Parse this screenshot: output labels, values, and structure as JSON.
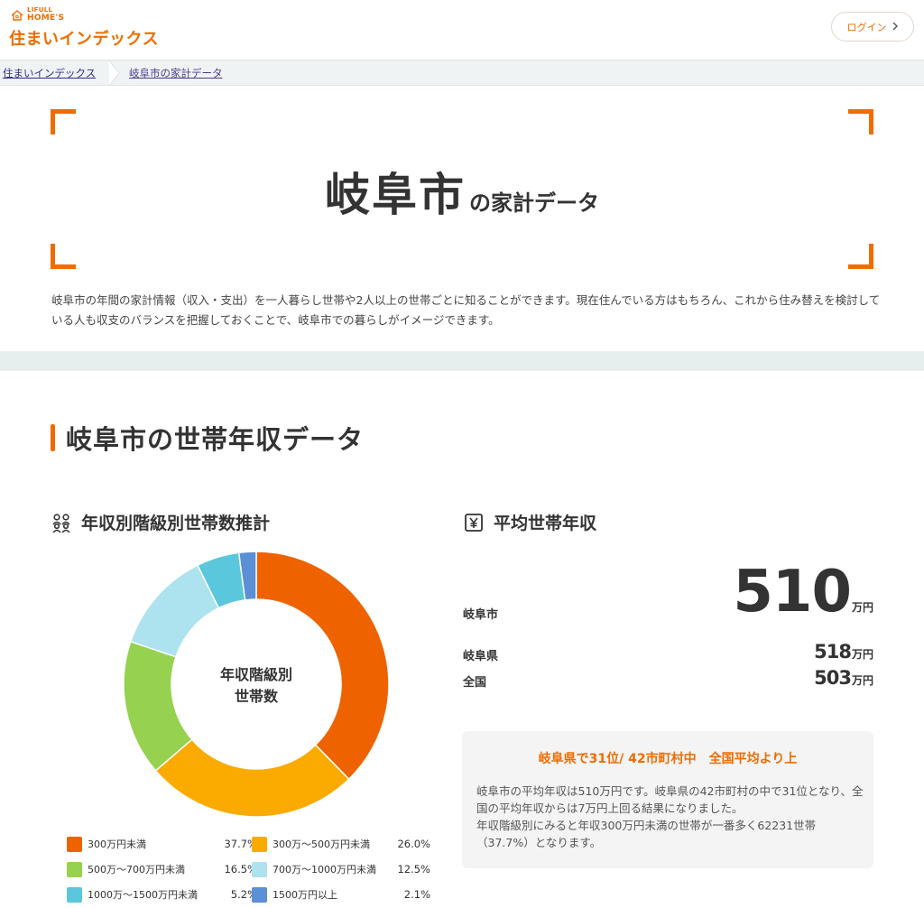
{
  "header": {
    "logo_line1": "LIFULL",
    "logo_line2": "HOME'S",
    "site_title": "住まいインデックス",
    "login_label": "ログイン",
    "login_chevron": "〉"
  },
  "breadcrumb": {
    "items": [
      "住まいインデックス",
      "岐阜市の家計データ"
    ]
  },
  "hero": {
    "city": "岐阜市",
    "suffix": "の家計データ",
    "description": "岐阜市の年間の家計情報（収入・支出）を一人暮らし世帯や2人以上の世帯ごとに知ることができます。現在住んでいる方はもちろん、これから住み替えを検討している人も収支のバランスを把握しておくことで、岐阜市での暮らしがイメージできます。"
  },
  "section": {
    "title": "岐阜市の世帯年収データ"
  },
  "distribution": {
    "heading": "年収別階級別世帯数推計",
    "center_line1": "年収階級別",
    "center_line2": "世帯数",
    "legend": [
      {
        "label": "300万円未満",
        "pct": "37.7%",
        "color": "#ee6300"
      },
      {
        "label": "300万～500万円未満",
        "pct": "26.0%",
        "color": "#fbaa00"
      },
      {
        "label": "500万～700万円未満",
        "pct": "16.5%",
        "color": "#96d150"
      },
      {
        "label": "700万～1000万円未満",
        "pct": "12.5%",
        "color": "#ade3ef"
      },
      {
        "label": "1000万～1500万円未満",
        "pct": "5.2%",
        "color": "#5bc7dc"
      },
      {
        "label": "1500万円以上",
        "pct": "2.1%",
        "color": "#5b8fd6"
      }
    ]
  },
  "chart_data": {
    "type": "pie",
    "categories": [
      "300万円未満",
      "300万～500万円未満",
      "500万～700万円未満",
      "700万～1000万円未満",
      "1000万～1500万円未満",
      "1500万円以上"
    ],
    "values": [
      37.7,
      26.0,
      16.5,
      12.5,
      5.2,
      2.1
    ],
    "colors": [
      "#ee6300",
      "#fbaa00",
      "#96d150",
      "#ade3ef",
      "#5bc7dc",
      "#5b8fd6"
    ],
    "title": "年収別階級別世帯数推計",
    "legend": "bottom"
  },
  "average": {
    "heading": "平均世帯年収",
    "city_label": "岐阜市",
    "city_value": "510",
    "pref_label": "岐阜県",
    "pref_value": "518",
    "nation_label": "全国",
    "nation_value": "503",
    "unit": "万円",
    "rank_headline": "岐阜県で31位/ 42市町村中　全国平均より上",
    "rank_text": "岐阜市の平均年収は510万円です。岐阜県の42市町村の中で31位となり、全国の平均年収からは7万円上回る結果になりました。\n年収階級別にみると年収300万円未満の世帯が一番多く62231世帯（37.7%）となります。"
  }
}
